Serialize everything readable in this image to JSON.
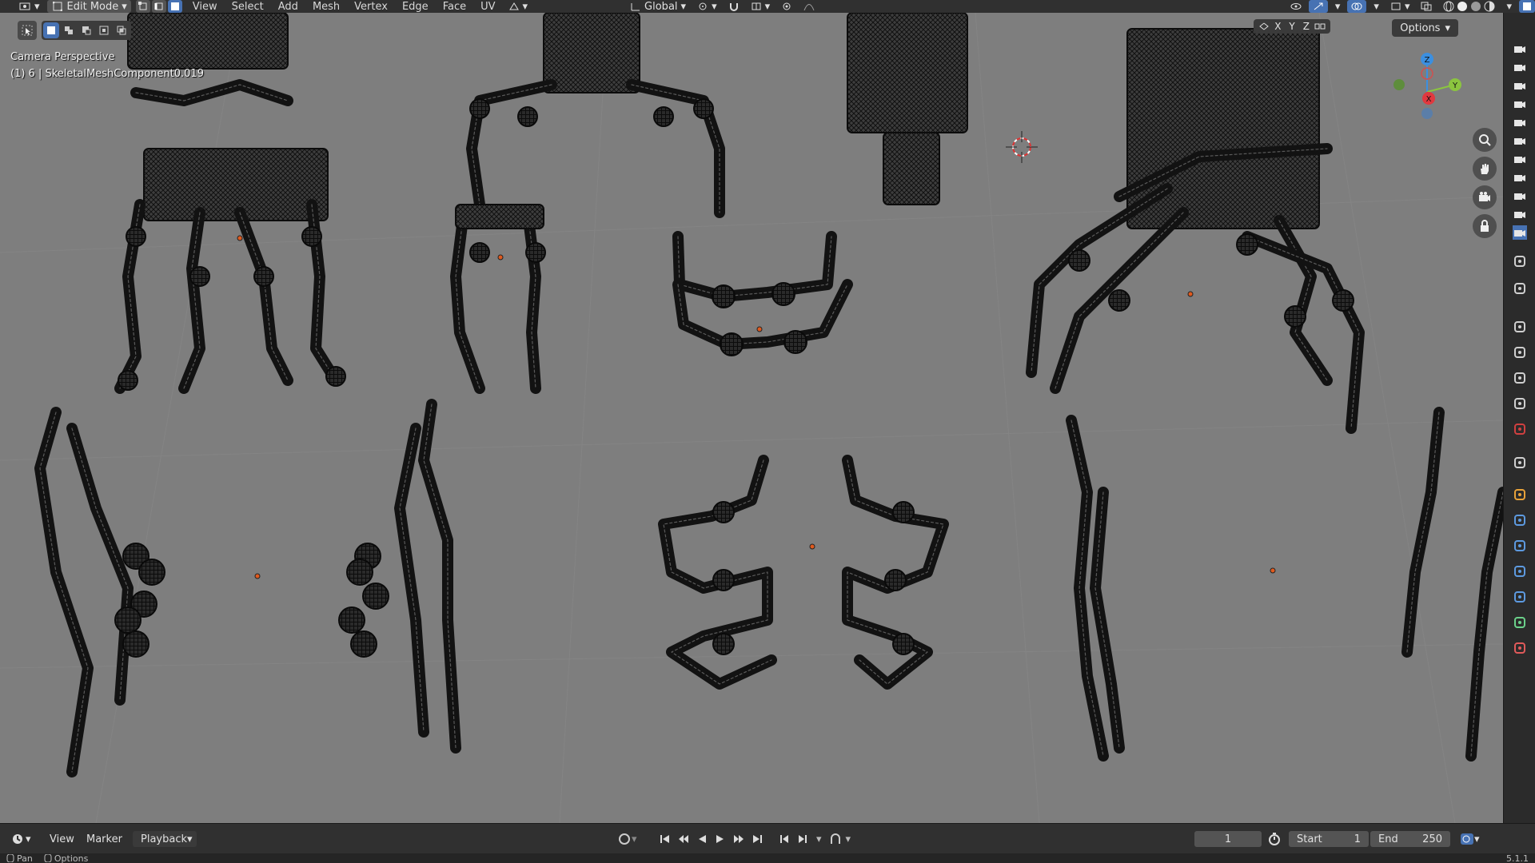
{
  "header": {
    "mode": "Edit Mode",
    "menus": [
      "View",
      "Select",
      "Add",
      "Mesh",
      "Vertex",
      "Edge",
      "Face",
      "UV"
    ],
    "orientation": "Global"
  },
  "viewport": {
    "overlay_line1": "Camera Perspective",
    "overlay_line2": "(1) 6 | SkeletalMeshComponent0.019",
    "axis_lock": [
      "X",
      "Y",
      "Z"
    ],
    "options_label": "Options",
    "gizmo": {
      "x": "X",
      "y": "Y",
      "z": "Z"
    },
    "colors": {
      "background": "#7e7e7e",
      "wire": "#141414",
      "origin": "#e05a1e",
      "axis_x": "#e0393f",
      "axis_y": "#8bc53f",
      "axis_z": "#3b8fe0"
    }
  },
  "timeline": {
    "menus": [
      "View",
      "Marker",
      "Playback"
    ],
    "current_frame": "1",
    "start_label": "Start",
    "start_value": "1",
    "end_label": "End",
    "end_value": "250"
  },
  "statusbar": {
    "left1": "Pan",
    "left2": "Options",
    "version": "5.1.1"
  }
}
